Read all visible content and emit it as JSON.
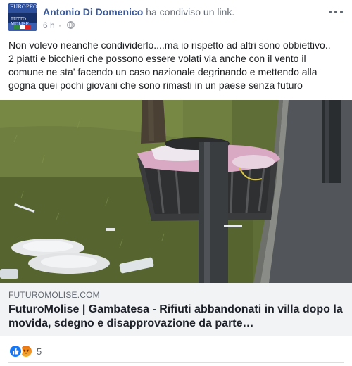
{
  "post": {
    "author": "Antonio Di Domenico",
    "action": "ha condiviso un link.",
    "time": "6 h",
    "privacy_icon": "globe-icon",
    "avatar_text_1": "EUROPEO",
    "avatar_text_2": "TUTTO MOLISE",
    "menu_icon": "more-options-icon",
    "text_lines": [
      "Non volevo neanche condividerlo....ma io rispetto ad altri sono obbiettivo..",
      "2 piatti e bicchieri che possono essere volati via anche con il vento il",
      "comune ne sta' facendo un caso nazionale degrinando e mettendo alla",
      "gogna quei pochi giovani che sono rimasti in un paese senza futuro"
    ]
  },
  "link": {
    "domain": "FUTUROMOLISE.COM",
    "title": "FuturoMolise | Gambatesa - Rifiuti abbandonati in villa dopo la movida, sdegno e disapprovazione da parte…"
  },
  "reactions": {
    "icons": [
      "like-icon",
      "angry-icon"
    ],
    "count": "5"
  },
  "colors": {
    "author": "#385898",
    "secondary_text": "#606770",
    "link_box_bg": "#f2f3f5",
    "like_blue": "#1877f2",
    "angry_orange": "#e9710f"
  }
}
